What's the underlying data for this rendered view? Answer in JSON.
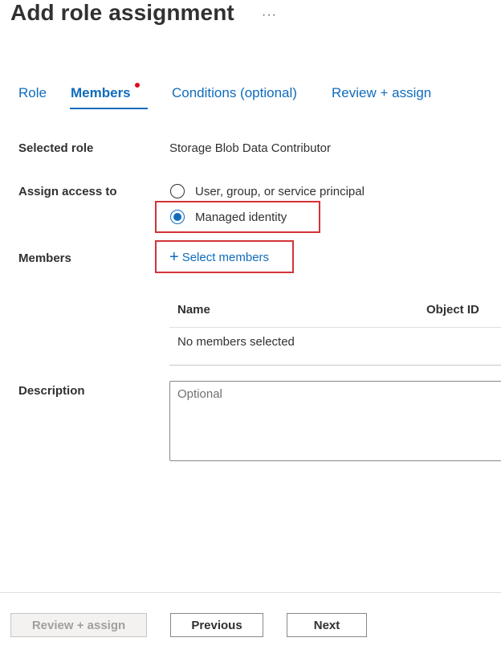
{
  "header": {
    "title": "Add role assignment",
    "more_icon": "ellipsis-icon",
    "more_label": "···"
  },
  "tabs": [
    {
      "label": "Role",
      "active": false
    },
    {
      "label": "Members",
      "active": true,
      "has_indicator": true
    },
    {
      "label": "Conditions (optional)",
      "active": false
    },
    {
      "label": "Review + assign",
      "active": false
    }
  ],
  "form": {
    "selected_role_label": "Selected role",
    "selected_role_value": "Storage Blob Data Contributor",
    "assign_access_label": "Assign access to",
    "options": [
      {
        "label": "User, group, or service principal",
        "checked": false
      },
      {
        "label": "Managed identity",
        "checked": true
      }
    ],
    "members_label": "Members",
    "select_members_icon": "plus-icon",
    "select_members_label": "Select members",
    "table": {
      "columns": [
        "Name",
        "Object ID"
      ],
      "empty_text": "No members selected"
    },
    "description_label": "Description",
    "description_placeholder": "Optional",
    "description_value": ""
  },
  "footer": {
    "review_assign_label": "Review + assign",
    "previous_label": "Previous",
    "next_label": "Next"
  },
  "colors": {
    "accent": "#0f6cbd",
    "highlight_box": "#d13438",
    "indicator_dot": "#e00b1c"
  }
}
